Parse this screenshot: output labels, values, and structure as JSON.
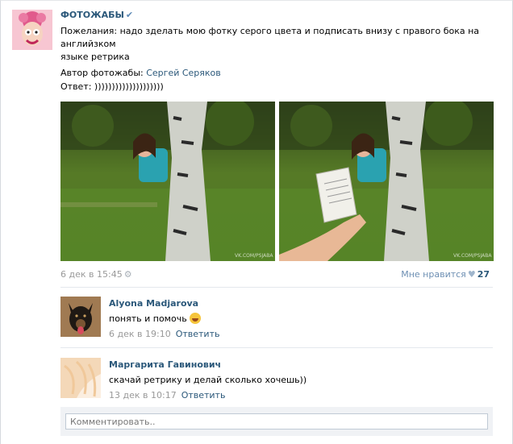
{
  "post": {
    "group_name": "ФОТОЖАБЫ",
    "verified_icon": "check-icon",
    "text_line1": "Пожелания: надо зделать мою фотку серого цвета и подписать внизу с правого бока на английзком",
    "text_line2": "языке ретрика",
    "author_label": "Автор фотожабы:",
    "author_name": "Сергей Серяков",
    "answer_label": "Ответ: ))))))))))))))))))))",
    "date": "6 дек в 15:45",
    "likes_label": "Мне нравится",
    "likes_count": "27",
    "watermark": "VK.COM/PSJABA"
  },
  "comments": [
    {
      "author": "Alyona Madjarova",
      "text": "понять и помочь",
      "emoji": "laughing-tears-emoji",
      "date": "6 дек в 19:10",
      "reply_label": "Ответить"
    },
    {
      "author": "Маргарита Гавинович",
      "text": "скачай ретрику и делай сколько хочешь))",
      "date": "13 дек в 10:17",
      "reply_label": "Ответить"
    }
  ],
  "composer": {
    "placeholder": "Комментировать.."
  },
  "colors": {
    "link": "#2b587a",
    "meta": "#999999",
    "separator": "#e4e8ed",
    "composer_bg": "#f0f2f5"
  }
}
